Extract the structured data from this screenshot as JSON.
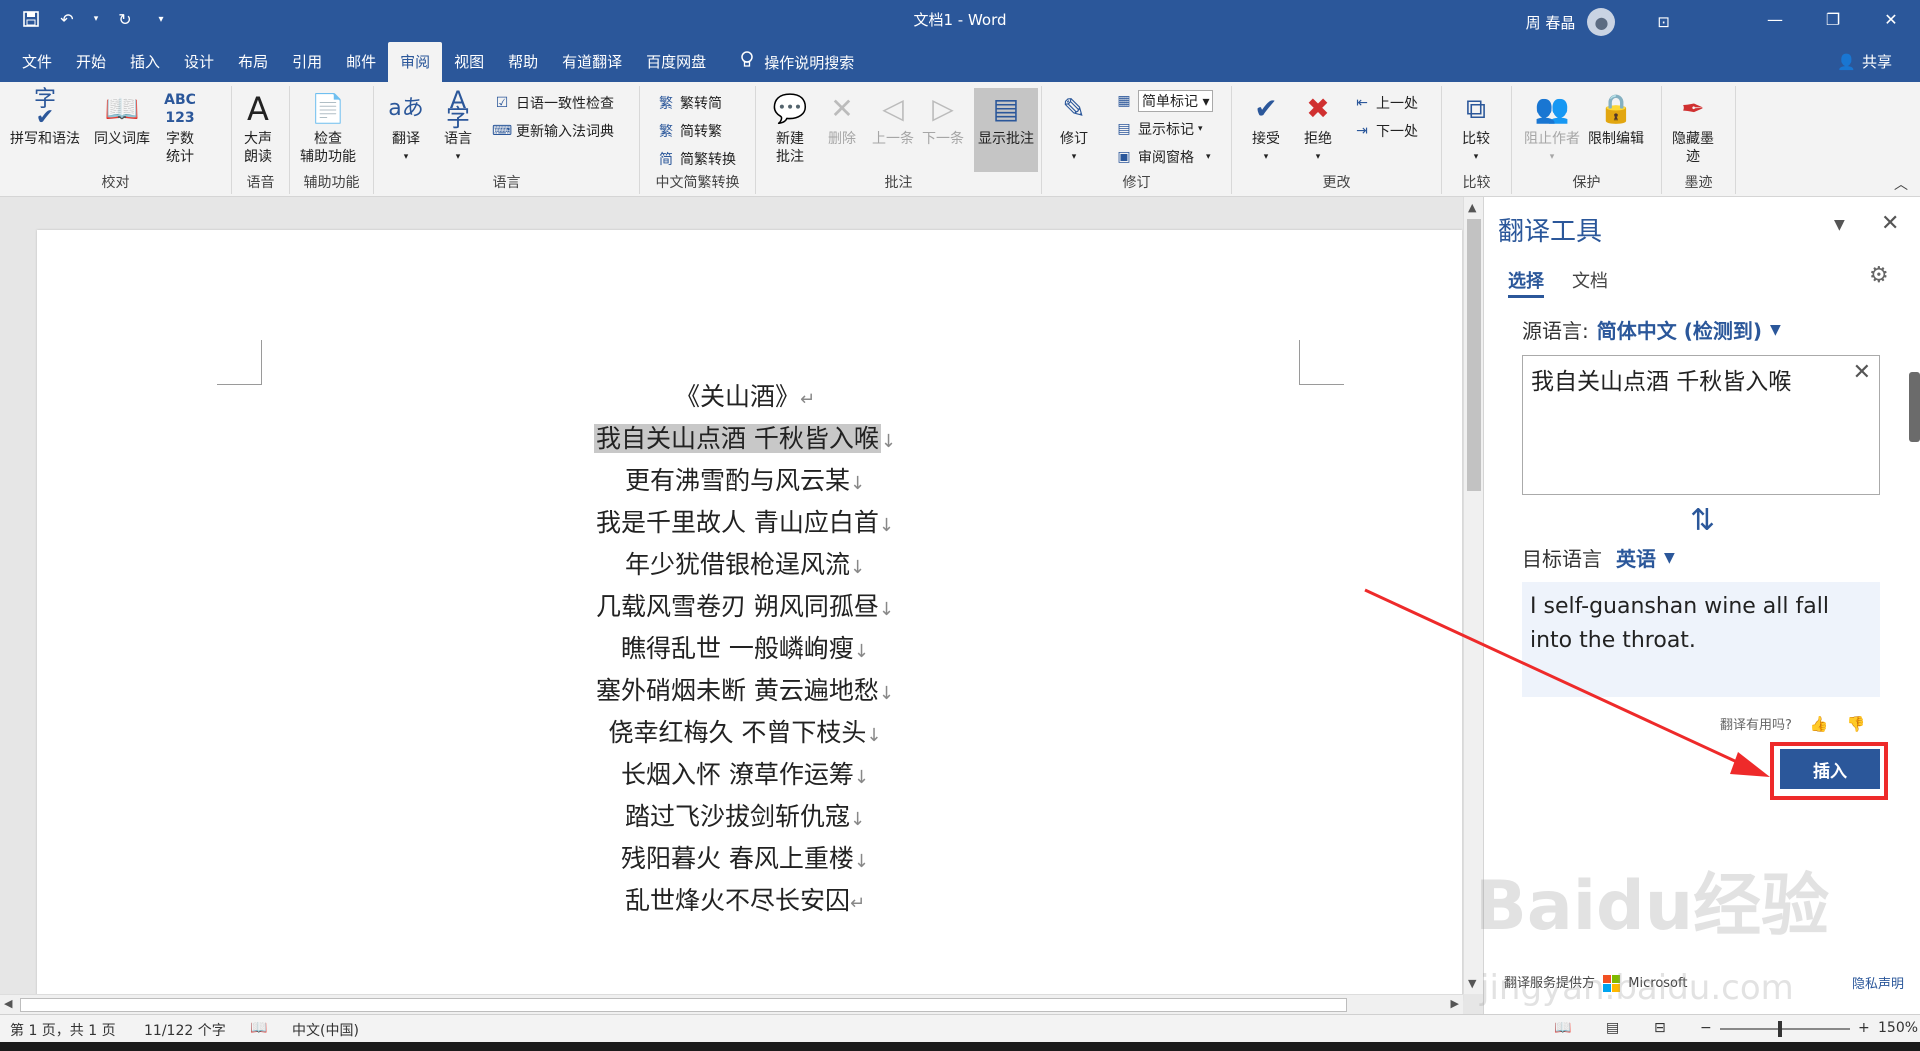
{
  "window": {
    "title": "文档1 - Word",
    "user_name": "周 春晶",
    "share_label": "共享"
  },
  "tabs": [
    "文件",
    "开始",
    "插入",
    "设计",
    "布局",
    "引用",
    "邮件",
    "审阅",
    "视图",
    "帮助",
    "有道翻译",
    "百度网盘"
  ],
  "active_tab": "审阅",
  "tell_me": "操作说明搜索",
  "ribbon": {
    "groups": {
      "proofing": "校对",
      "speech": "语音",
      "accessibility": "辅助功能",
      "language": "语言",
      "chinese_conversion": "中文简繁转换",
      "comments": "批注",
      "tracking": "修订",
      "changes": "更改",
      "compare": "比较",
      "protect": "保护",
      "ink": "墨迹"
    },
    "buttons": {
      "spelling": "拼写和语法",
      "thesaurus": "同义词库",
      "word_count_1": "字数",
      "word_count_2": "统计",
      "read_aloud_1": "大声",
      "read_aloud_2": "朗读",
      "check_access_1": "检查",
      "check_access_2": "辅助功能",
      "translate": "翻译",
      "language": "语言",
      "jp_consistency": "日语一致性检查",
      "update_ime": "更新输入法词典",
      "trad_simp": "繁转简",
      "simp_trad": "简转繁",
      "convert": "简繁转换",
      "new_comment_1": "新建",
      "new_comment_2": "批注",
      "delete": "删除",
      "previous": "上一条",
      "next": "下一条",
      "show_comments": "显示批注",
      "track_changes": "修订",
      "markup_select": "简单标记",
      "show_markup": "显示标记",
      "reviewing_pane": "审阅窗格",
      "accept": "接受",
      "reject": "拒绝",
      "prev_change": "上一处",
      "next_change": "下一处",
      "compare": "比较",
      "block_authors": "阻止作者",
      "restrict_editing": "限制编辑",
      "hide_ink_1": "隐藏墨",
      "hide_ink_2": "迹"
    }
  },
  "document": {
    "lines": [
      "《关山酒》",
      "我自关山点酒  千秋皆入喉",
      "更有沸雪酌与风云某",
      "我是千里故人  青山应白首",
      "年少犹借银枪逞风流",
      "几载风雪卷刃  朔风同孤昼",
      "瞧得乱世  一般嶙峋瘦",
      "塞外硝烟未断  黄云遍地愁",
      "侥幸红梅久  不曾下枝头",
      "长烟入怀  潦草作运筹",
      "踏过飞沙拔剑斩仇寇",
      "残阳暮火  春风上重楼",
      "乱世烽火不尽长安囚"
    ],
    "para_mark": "↵",
    "line_break": "↓"
  },
  "translator": {
    "title": "翻译工具",
    "tab_selection": "选择",
    "tab_document": "文档",
    "source_label": "源语言:",
    "source_value": "简体中文 (检测到)",
    "source_text": "我自关山点酒 千秋皆入喉",
    "target_label": "目标语言",
    "target_value": "英语",
    "output_text": "I self-guanshan wine all fall into the throat.",
    "feedback_label": "翻译有用吗?",
    "insert_label": "插入",
    "footer_left": "翻译服务提供方",
    "footer_brand": "Microsoft",
    "footer_right": "隐私声明"
  },
  "statusbar": {
    "page": "第 1 页，共 1 页",
    "words": "11/122 个字",
    "language": "中文(中国)",
    "zoom": "150%"
  },
  "watermark": {
    "brand": "Baidu经验",
    "url": "jingyan.baidu.com"
  },
  "colors": {
    "accent": "#2b579a",
    "annotation": "#ee2a2a"
  }
}
